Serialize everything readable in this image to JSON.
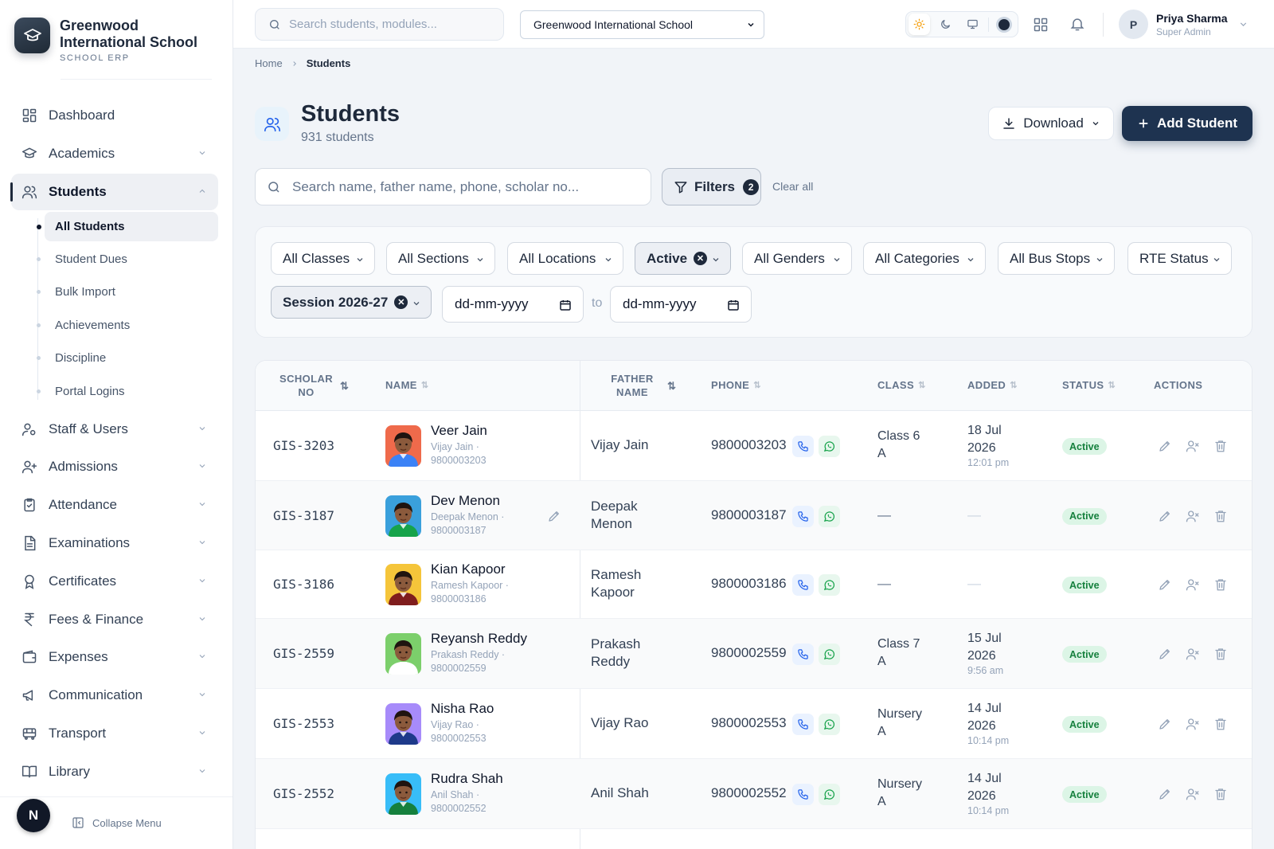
{
  "brand": {
    "name": "Greenwood International School",
    "subtitle": "SCHOOL ERP"
  },
  "sidebar": {
    "items": [
      {
        "label": "Dashboard",
        "icon": "dashboard-icon"
      },
      {
        "label": "Academics",
        "icon": "graduation-cap-icon"
      },
      {
        "label": "Students",
        "icon": "users-icon",
        "active": true
      },
      {
        "label": "Staff & Users",
        "icon": "staff-icon"
      },
      {
        "label": "Admissions",
        "icon": "user-plus-icon"
      },
      {
        "label": "Attendance",
        "icon": "clipboard-check-icon"
      },
      {
        "label": "Examinations",
        "icon": "file-text-icon"
      },
      {
        "label": "Certificates",
        "icon": "award-icon"
      },
      {
        "label": "Fees & Finance",
        "icon": "rupee-icon"
      },
      {
        "label": "Expenses",
        "icon": "wallet-icon"
      },
      {
        "label": "Communication",
        "icon": "megaphone-icon"
      },
      {
        "label": "Transport",
        "icon": "bus-icon"
      },
      {
        "label": "Library",
        "icon": "book-icon"
      }
    ],
    "sub_items": [
      "All Students",
      "Student Dues",
      "Bulk Import",
      "Achievements",
      "Discipline",
      "Portal Logins"
    ],
    "avatar_letter": "N",
    "collapse_label": "Collapse Menu"
  },
  "topbar": {
    "search_placeholder": "Search students, modules...",
    "school_select": "Greenwood International School",
    "user": {
      "initial": "P",
      "name": "Priya Sharma",
      "role": "Super Admin"
    }
  },
  "breadcrumb": {
    "home": "Home",
    "current": "Students"
  },
  "header": {
    "title": "Students",
    "count": "931 students",
    "download_label": "Download",
    "add_label": "Add Student"
  },
  "list": {
    "search_placeholder": "Search name, father name, phone, scholar no...",
    "filters_label": "Filters",
    "filters_count": "2",
    "clear_all": "Clear all"
  },
  "filters": {
    "chips": [
      "All Classes",
      "All Sections",
      "All Locations",
      "Active",
      "All Genders",
      "All Categories",
      "All Bus Stops",
      "RTE Status"
    ],
    "session": "Session 2026-27",
    "date_from": "dd-mm-yyyy",
    "to": "to",
    "date_to": "dd-mm-yyyy"
  },
  "table": {
    "headers": {
      "scholar": "SCHOLAR NO",
      "name": "NAME",
      "father": "FATHER NAME",
      "phone": "PHONE",
      "class": "CLASS",
      "added": "ADDED",
      "status": "STATUS",
      "actions": "ACTIONS"
    },
    "rows": [
      {
        "scholar": "GIS-3203",
        "name": "Veer Jain",
        "sub1": "Vijay Jain ·",
        "sub2": "9800003203",
        "father": "Vijay Jain",
        "phone": "9800003203",
        "class1": "Class 6",
        "class2": "A",
        "added1": "18 Jul",
        "added2": "2026",
        "added3": "12:01 pm",
        "status": "Active",
        "photo_bg": "#ef6a4b",
        "shirt": "#3b82f6"
      },
      {
        "scholar": "GIS-3187",
        "name": "Dev Menon",
        "sub1": "Deepak Menon ·",
        "sub2": "9800003187",
        "father1": "Deepak",
        "father2": "Menon",
        "phone": "9800003187",
        "class_dash": "—",
        "added_dash": "—",
        "status": "Active",
        "photo_bg": "#3aa0dc",
        "shirt": "#16a34a"
      },
      {
        "scholar": "GIS-3186",
        "name": "Kian Kapoor",
        "sub1": "Ramesh Kapoor ·",
        "sub2": "9800003186",
        "father1": "Ramesh",
        "father2": "Kapoor",
        "phone": "9800003186",
        "class_dash": "—",
        "added_dash": "—",
        "status": "Active",
        "photo_bg": "#f5c53a",
        "shirt": "#7f1d1d"
      },
      {
        "scholar": "GIS-2559",
        "name": "Reyansh Reddy",
        "sub1": "Prakash Reddy ·",
        "sub2": "9800002559",
        "father1": "Prakash",
        "father2": "Reddy",
        "phone": "9800002559",
        "class1": "Class 7",
        "class2": "A",
        "added1": "15 Jul",
        "added2": "2026",
        "added3": "9:56 am",
        "status": "Active",
        "photo_bg": "#7ccf6b",
        "shirt": "#ffffff"
      },
      {
        "scholar": "GIS-2553",
        "name": "Nisha Rao",
        "sub1": "Vijay Rao ·",
        "sub2": "9800002553",
        "father": "Vijay Rao",
        "phone": "9800002553",
        "class1": "Nursery",
        "class2": "A",
        "added1": "14 Jul",
        "added2": "2026",
        "added3": "10:14 pm",
        "status": "Active",
        "photo_bg": "#a78bfa",
        "shirt": "#1e3a8a"
      },
      {
        "scholar": "GIS-2552",
        "name": "Rudra Shah",
        "sub1": "Anil Shah ·",
        "sub2": "9800002552",
        "father": "Anil Shah",
        "phone": "9800002552",
        "class1": "Nursery",
        "class2": "A",
        "added1": "14 Jul",
        "added2": "2026",
        "added3": "10:14 pm",
        "status": "Active",
        "photo_bg": "#38bdf8",
        "shirt": "#15803d"
      }
    ]
  }
}
